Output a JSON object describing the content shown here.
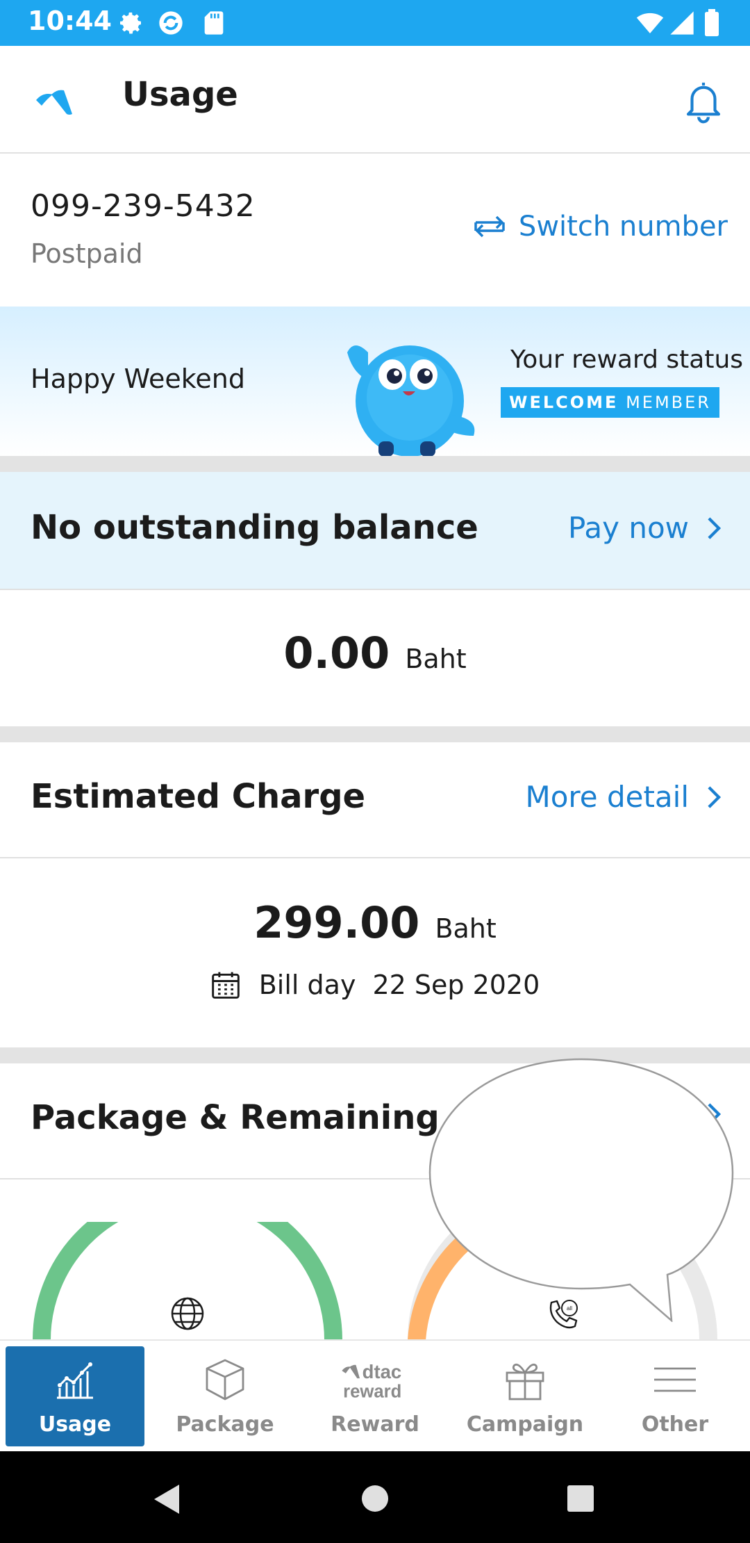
{
  "status_bar": {
    "time": "10:44"
  },
  "header": {
    "title": "Usage"
  },
  "account": {
    "number": "099-239-5432",
    "plan": "Postpaid",
    "switch_label": "Switch number"
  },
  "banner": {
    "greeting": "Happy Weekend",
    "reward_status_label": "Your reward status",
    "badge_part1": "WELCOME",
    "badge_part2": "MEMBER"
  },
  "balance": {
    "title": "No outstanding balance",
    "action": "Pay now",
    "amount": "0.00",
    "unit": "Baht"
  },
  "estimated": {
    "title": "Estimated Charge",
    "action": "More detail",
    "amount": "299.00",
    "unit": "Baht",
    "bill_label": "Bill day",
    "bill_date": "22 Sep 2020"
  },
  "package": {
    "title": "Package & Remaining"
  },
  "bottom_nav": {
    "items": [
      {
        "label": "Usage",
        "icon": "chart-icon",
        "active": true
      },
      {
        "label": "Package",
        "icon": "box-icon",
        "active": false
      },
      {
        "label": "Reward",
        "icon": "dtac-reward-logo",
        "active": false
      },
      {
        "label": "Campaign",
        "icon": "gift-icon",
        "active": false
      },
      {
        "label": "Other",
        "icon": "menu-icon",
        "active": false
      }
    ],
    "reward_logo_line1": "dtac",
    "reward_logo_line2": "reward"
  },
  "colors": {
    "brand_blue": "#1ea7f0",
    "link_blue": "#1a7fd0",
    "nav_active": "#1b6fae",
    "gauge_green": "#6cc58b",
    "gauge_orange": "#ffb36b"
  }
}
